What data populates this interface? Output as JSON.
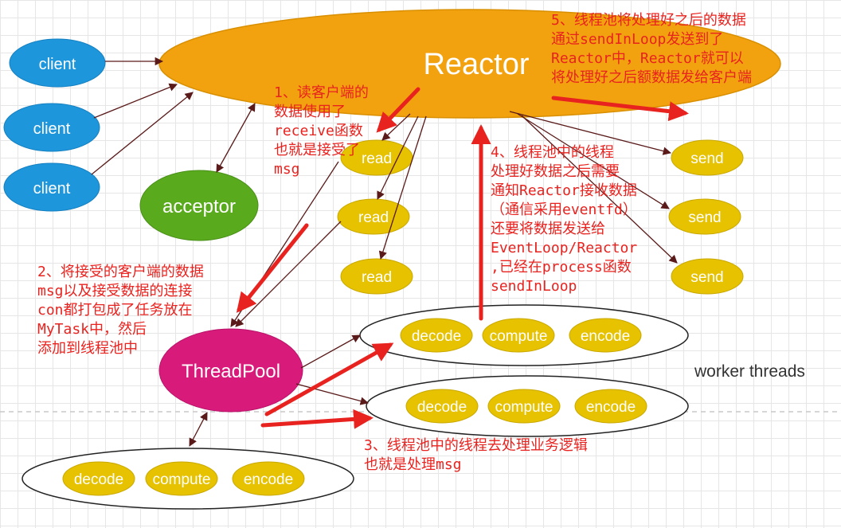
{
  "nodes": {
    "reactor": "Reactor",
    "client": "client",
    "acceptor": "acceptor",
    "read": "read",
    "send": "send",
    "threadpool": "ThreadPool",
    "decode": "decode",
    "compute": "compute",
    "encode": "encode"
  },
  "labels": {
    "worker_threads": "worker threads"
  },
  "notes": {
    "note1": [
      "1、读客户端的",
      "数据使用了",
      "receive函数",
      "也就是接受了",
      "msg"
    ],
    "note2": [
      "2、将接受的客户端的数据",
      "msg以及接受数据的连接",
      "con都打包成了任务放在",
      "MyTask中，然后",
      "添加到线程池中"
    ],
    "note3": [
      "3、线程池中的线程去处理业务逻辑",
      "也就是处理msg"
    ],
    "note4": [
      "4、线程池中的线程",
      "处理好数据之后需要",
      "通知Reactor接收数据",
      "（通信采用eventfd）",
      "还要将数据发送给",
      "EventLoop/Reactor",
      ",已经在process函数",
      "sendInLoop"
    ],
    "note5": [
      "5、线程池将处理好之后的数据",
      "通过sendInLoop发送到了",
      "Reactor中，Reactor就可以",
      "将处理好之后额数据发给客户端"
    ]
  },
  "colors": {
    "reactor": "#f2a20f",
    "client": "#1e96dc",
    "acceptor": "#5aaa1e",
    "read_send": "#e6c200",
    "threadpool": "#d81b7a",
    "annotation": "#e8231f",
    "connector": "#5a1a1a"
  }
}
